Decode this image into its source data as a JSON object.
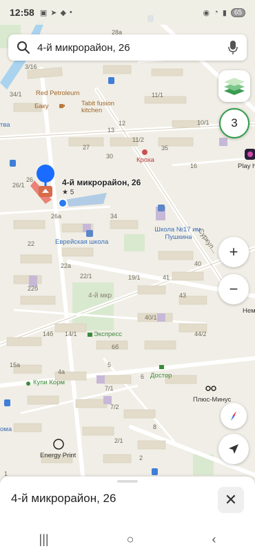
{
  "status": {
    "time": "12:58",
    "battery": "65"
  },
  "search": {
    "query": "4-й микрорайон, 26"
  },
  "pin": {
    "title": "4-й микрорайон, 26",
    "rating": "★ 5"
  },
  "map": {
    "house_numbers": [
      "28a",
      "3/16",
      "34/1",
      "26/1",
      "26",
      "26a",
      "22",
      "22a",
      "22б",
      "22/1",
      "19/1",
      "14б",
      "14/1",
      "15a",
      "6б",
      "4a",
      "7/1",
      "7/2",
      "2/1",
      "2",
      "5",
      "8",
      "6",
      "11/1",
      "11/2",
      "10/1",
      "12",
      "13",
      "27",
      "30",
      "34",
      "35",
      "40",
      "41",
      "43",
      "44/2",
      "40/1",
      "16",
      "1"
    ],
    "pois": {
      "red_petroleum": "Red Petroleum",
      "baku": "Баку",
      "tabit": "Tabit fusion kitchen",
      "kroha": "Кроха",
      "play": "Play h",
      "school": "Школа №17 им. Пушкина",
      "jewish_school": "Еврейская школа",
      "express": "Экспресс",
      "dostor": "Достор",
      "kupi_korm": "Купи Корм",
      "plus_minus": "Плюс-Минус",
      "energy_print": "Energy Print",
      "nem": "Нем",
      "street": "Суркул...",
      "micro": "4-й мкр",
      "otva": "тва",
      "oma": "ома"
    }
  },
  "controls": {
    "counter": "3",
    "zoom_in": "+",
    "zoom_out": "−"
  },
  "sheet": {
    "title": "4-й микрорайон, 26",
    "close": "✕"
  },
  "nav": {
    "recent": "|||",
    "home": "○",
    "back": "‹"
  },
  "colors": {
    "accent_blue": "#1a6bff",
    "counter_ring": "#2f9b4b",
    "building": "#e3dccb",
    "road": "#ffffff",
    "park": "#d9e9cf"
  }
}
